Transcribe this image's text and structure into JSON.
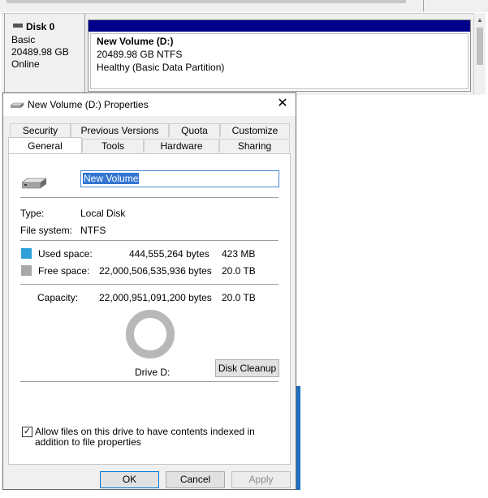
{
  "disk_management": {
    "disk": {
      "name": "Disk 0",
      "type": "Basic",
      "size": "20489.98 GB",
      "status": "Online"
    },
    "partition": {
      "name": "New Volume  (D:)",
      "size_fs": "20489.98 GB NTFS",
      "health": "Healthy (Basic Data Partition)"
    }
  },
  "dialog": {
    "title": "New Volume (D:) Properties",
    "tabs_row1": [
      "Security",
      "Previous Versions",
      "Quota",
      "Customize"
    ],
    "tabs_row2": [
      "General",
      "Tools",
      "Hardware",
      "Sharing"
    ],
    "active_tab": "General",
    "volume_name": "New Volume",
    "type_label": "Type:",
    "type_value": "Local Disk",
    "fs_label": "File system:",
    "fs_value": "NTFS",
    "used": {
      "label": "Used space:",
      "bytes": "444,555,264 bytes",
      "size": "423 MB",
      "color": "#2d9fd9"
    },
    "free": {
      "label": "Free space:",
      "bytes": "22,000,506,535,936 bytes",
      "size": "20.0 TB",
      "color": "#a8a8a8"
    },
    "capacity": {
      "label": "Capacity:",
      "bytes": "22,000,951,091,200 bytes",
      "size": "20.0 TB"
    },
    "drive_label": "Drive D:",
    "disk_cleanup": "Disk Cleanup",
    "index_checkbox": {
      "checked": true,
      "label": "Allow files on this drive to have contents indexed in addition to file properties"
    },
    "buttons": {
      "ok": "OK",
      "cancel": "Cancel",
      "apply": "Apply"
    }
  }
}
